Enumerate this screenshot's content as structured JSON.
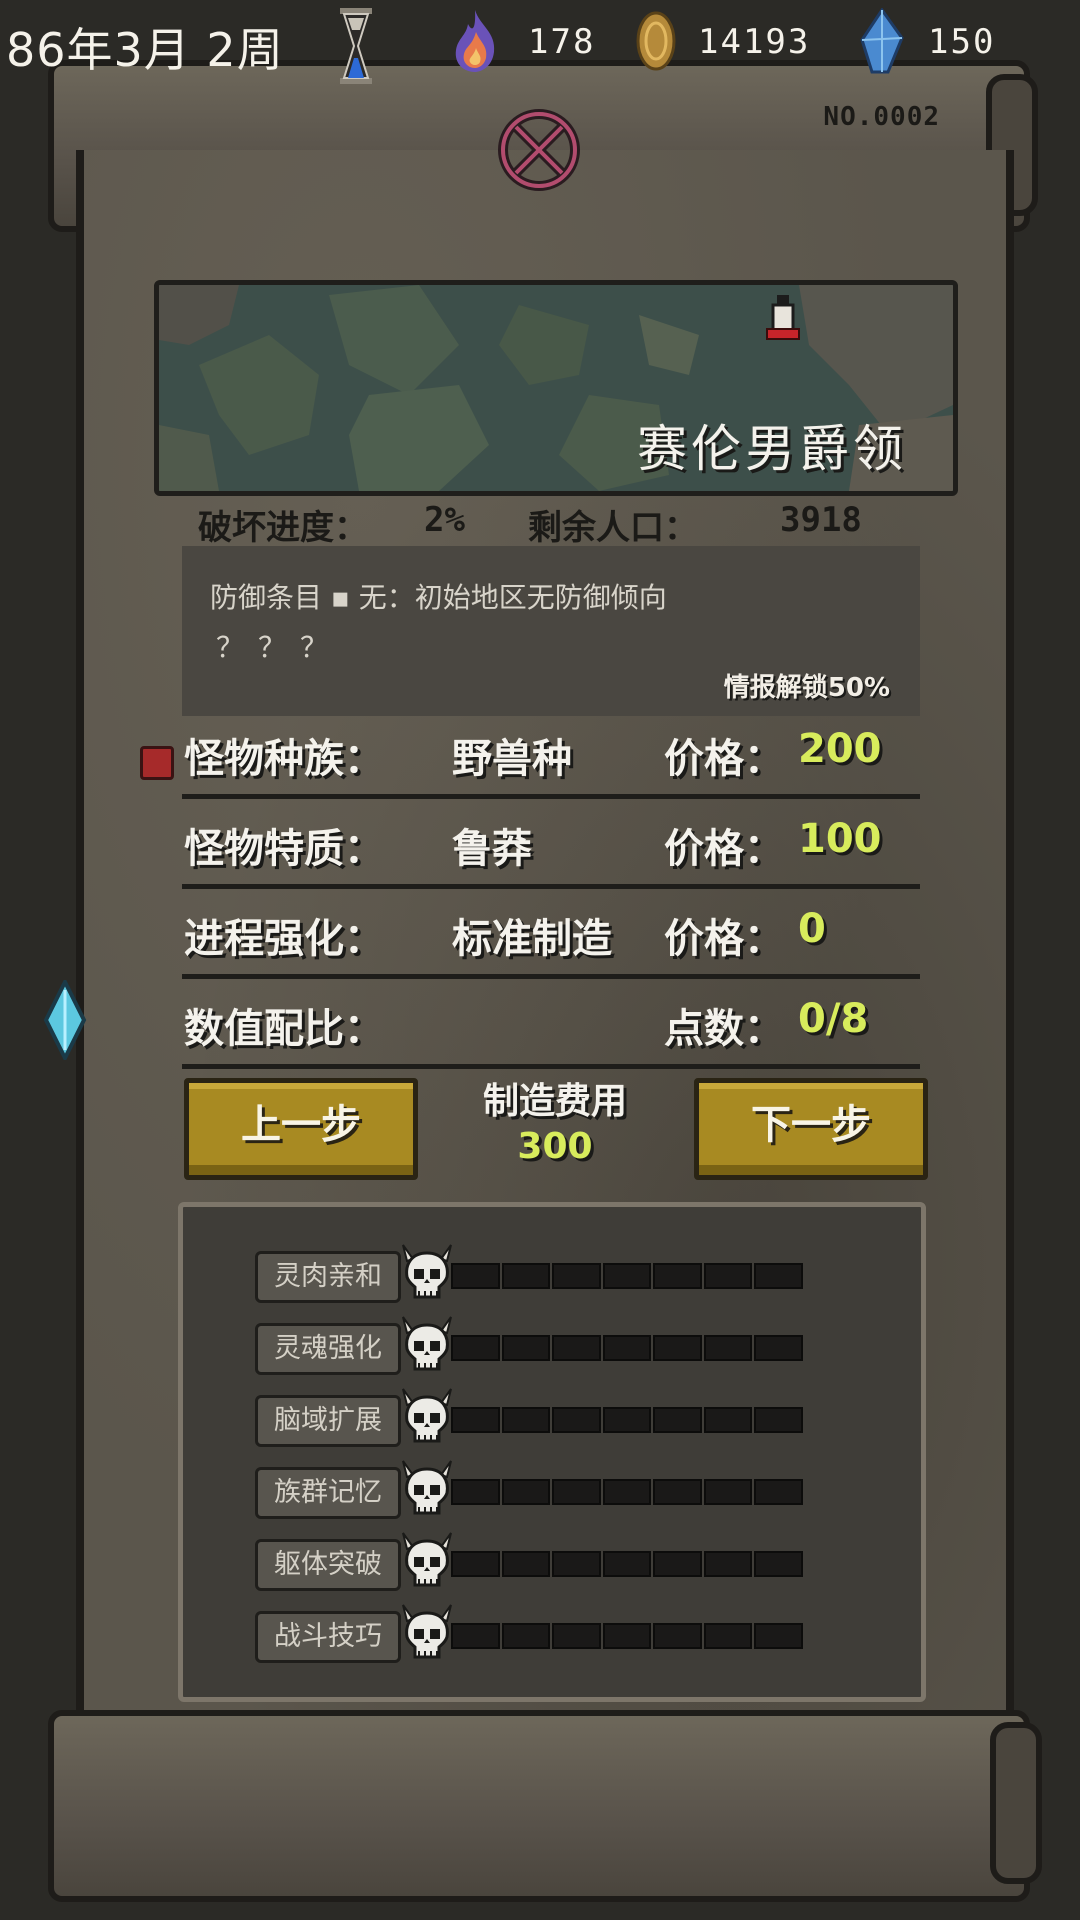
{
  "hud": {
    "date": "86年3月 2周",
    "fire": "178",
    "gold": "14193",
    "crystal": "150"
  },
  "scroll": {
    "serial": "NO.0002"
  },
  "map": {
    "region_name": "赛伦男爵领"
  },
  "stats": {
    "destroy_label": "破坏进度：",
    "destroy_value": "2%",
    "population_label": "剩余人口：",
    "population_value": "3918"
  },
  "info": {
    "line1": "防御条目 ▪ 无：初始地区无防御倾向",
    "line2": "？？？",
    "unlock": "情报解锁50%"
  },
  "rows": [
    {
      "label": "怪物种族：",
      "value": "野兽种",
      "price_label": "价格：",
      "price": "200"
    },
    {
      "label": "怪物特质：",
      "value": "鲁莽",
      "price_label": "价格：",
      "price": "100"
    },
    {
      "label": "进程强化：",
      "value": "标准制造",
      "price_label": "价格：",
      "price": "0"
    },
    {
      "label": "数值配比：",
      "value": "",
      "price_label": "点数：",
      "price": "0/8"
    }
  ],
  "buttons": {
    "prev": "上一步",
    "next": "下一步",
    "cost_title": "制造费用",
    "cost_value": "300"
  },
  "attributes": [
    {
      "label": "灵肉亲和",
      "filled": 0,
      "max": 7
    },
    {
      "label": "灵魂强化",
      "filled": 0,
      "max": 7
    },
    {
      "label": "脑域扩展",
      "filled": 0,
      "max": 7
    },
    {
      "label": "族群记忆",
      "filled": 0,
      "max": 7
    },
    {
      "label": "躯体突破",
      "filled": 0,
      "max": 7
    },
    {
      "label": "战斗技巧",
      "filled": 0,
      "max": 7
    }
  ],
  "colors": {
    "accent_price": "#d8ec5c",
    "button": "#a88a22",
    "marker": "#a62a2a"
  }
}
